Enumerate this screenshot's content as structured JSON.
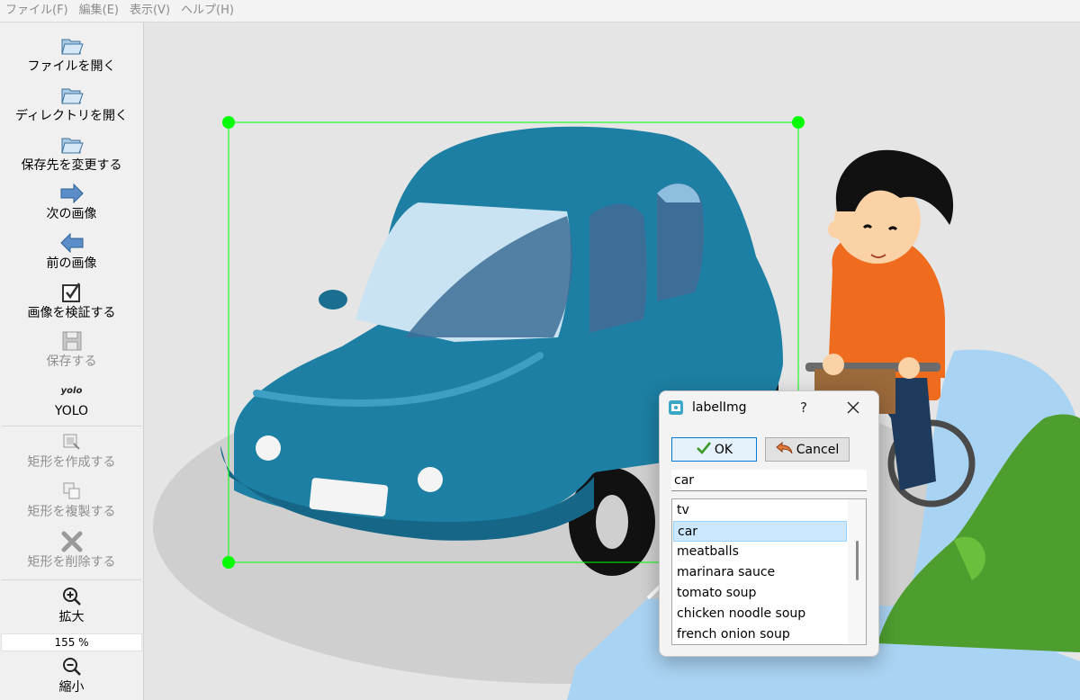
{
  "menu": [
    "ファイル(F)",
    "編集(E)",
    "表示(V)",
    "ヘルプ(H)"
  ],
  "toolbar": {
    "open_file": "ファイルを開く",
    "open_dir": "ディレクトリを開く",
    "change_save_dir": "保存先を変更する",
    "next_image": "次の画像",
    "prev_image": "前の画像",
    "verify_image": "画像を検証する",
    "save": "保存する",
    "format_icon_text": "yolo",
    "format": "YOLO",
    "create_rect": "矩形を作成する",
    "duplicate_rect": "矩形を複製する",
    "delete_rect": "矩形を削除する",
    "zoom_in": "拡大",
    "zoom_value": "155 %",
    "zoom_out": "縮小"
  },
  "dialog": {
    "title": "labelImg",
    "help": "?",
    "ok_label": "OK",
    "cancel_label": "Cancel",
    "input_value": "car",
    "labels": [
      "tv",
      "car",
      "meatballs",
      "marinara sauce",
      "tomato soup",
      "chicken noodle soup",
      "french onion soup"
    ],
    "selected_index": 1
  },
  "colors": {
    "bbox": "#00ff00",
    "car_body": "#1d7fa3",
    "shirt": "#ee6a1c",
    "selection": "#cce8ff"
  }
}
